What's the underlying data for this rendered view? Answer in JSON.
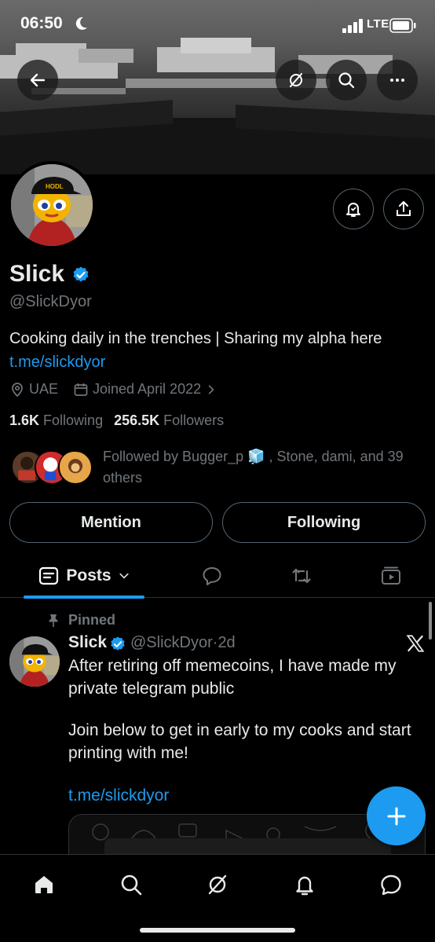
{
  "status_bar": {
    "time": "06:50",
    "network": "LTE"
  },
  "profile": {
    "display_name": "Slick",
    "handle": "@SlickDyor",
    "bio": "Cooking daily in the trenches | Sharing my alpha here",
    "bio_link": "t.me/slickdyor",
    "location": "UAE",
    "joined": "Joined April 2022",
    "following_count": "1.6K",
    "following_label": "Following",
    "followers_count": "256.5K",
    "followers_label": "Followers",
    "followed_by": "Followed by Bugger_p 🧊 , Stone, dami, and 39 others",
    "avatar_cap_text": "HODL"
  },
  "actions": {
    "mention_label": "Mention",
    "following_label": "Following"
  },
  "tabs": {
    "posts_label": "Posts"
  },
  "pinned_tweet": {
    "pinned_label": "Pinned",
    "author_name": "Slick",
    "author_handle": "@SlickDyor",
    "time_ago": "2d",
    "line1": "After retiring off memecoins, I have made my",
    "line2": "private telegram public",
    "line3": "Join below to get in early to my cooks and start",
    "line4": "printing with me!",
    "link": "t.me/slickdyor"
  },
  "icons": {
    "back": "arrow-left-icon",
    "grok": "grok-icon",
    "search": "search-icon",
    "more": "more-icon",
    "notify": "bell-icon",
    "share": "share-icon",
    "location": "location-pin-icon",
    "calendar": "calendar-icon",
    "reply": "reply-icon",
    "retweet": "retweet-icon",
    "media": "media-icon",
    "compose": "plus-icon",
    "home": "home-icon",
    "communities": "message-icon"
  },
  "colors": {
    "accent": "#1d9bf0",
    "background": "#000000",
    "secondary_text": "#71767b",
    "border": "#2f3336"
  }
}
